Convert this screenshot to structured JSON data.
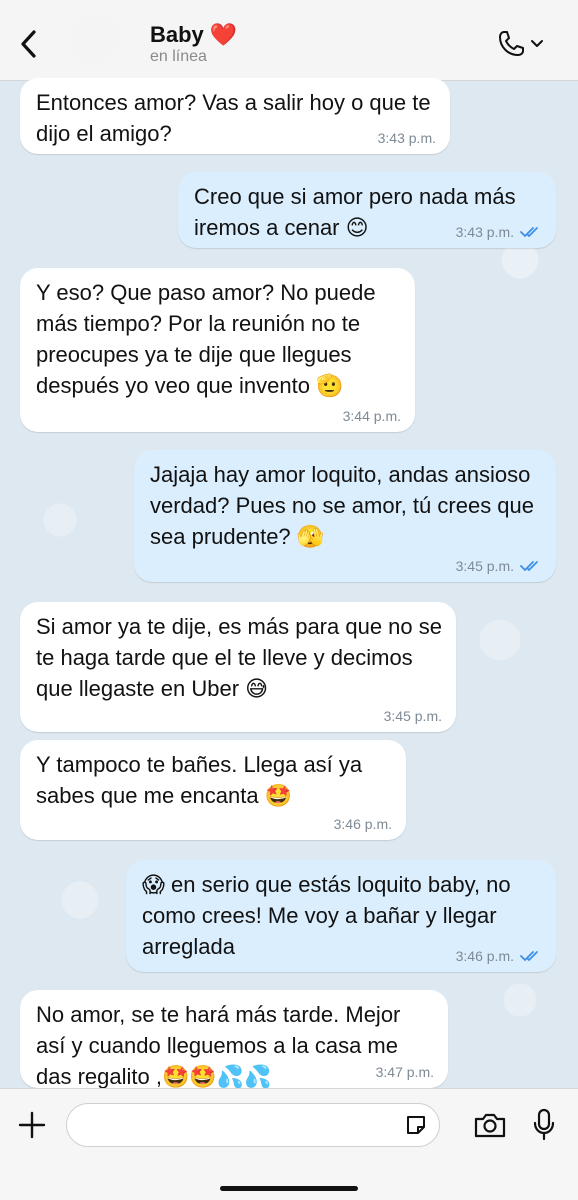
{
  "header": {
    "contact_name": "Baby ❤️",
    "status": "en línea"
  },
  "messages": [
    {
      "direction": "in",
      "text": "Entonces amor? Vas a salir hoy o que te dijo el amigo?",
      "time": "3:43 p.m."
    },
    {
      "direction": "out",
      "text": "Creo que si amor pero nada más iremos a cenar 😊",
      "time": "3:43 p.m.",
      "status": "read"
    },
    {
      "direction": "in",
      "text": "Y eso? Que paso amor? No puede más tiempo? Por la reunión no te preocupes ya te dije que llegues después yo veo que invento 🫡",
      "time": "3:44 p.m."
    },
    {
      "direction": "out",
      "text": "Jajaja hay amor loquito, andas ansioso verdad? Pues no se amor, tú crees que sea prudente? 🫣",
      "time": "3:45 p.m.",
      "status": "read"
    },
    {
      "direction": "in",
      "text": "Si amor ya te dije, es más para que no se te haga tarde que el te lleve y decimos que llegaste en Uber 😅",
      "time": "3:45 p.m."
    },
    {
      "direction": "in",
      "text": "Y tampoco te bañes. Llega así ya sabes que me encanta 🤩",
      "time": "3:46 p.m."
    },
    {
      "direction": "out",
      "text": "😱 en serio que estás loquito baby, no como crees! Me voy a bañar y llegar arreglada",
      "time": "3:46 p.m.",
      "status": "read"
    },
    {
      "direction": "in",
      "text": "No amor, se te hará más tarde. Mejor así y cuando lleguemos a la casa me das regalito ,🤩🤩💦💦",
      "time": "3:47 p.m."
    }
  ],
  "composer": {
    "placeholder": ""
  },
  "colors": {
    "incoming_bubble": "#ffffff",
    "outgoing_bubble": "#dbeefd",
    "read_ticks": "#3d8ee6",
    "background": "#dde8f1"
  },
  "icons": [
    "back-chevron-icon",
    "phone-icon",
    "chevron-down-icon",
    "plus-icon",
    "sticker-icon",
    "camera-icon",
    "microphone-icon",
    "double-check-icon"
  ]
}
